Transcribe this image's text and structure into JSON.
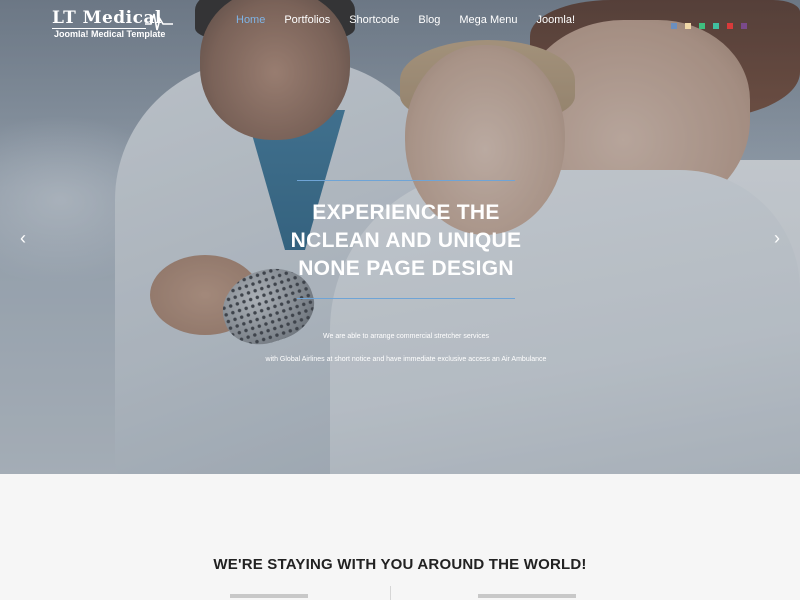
{
  "logo": {
    "title": "LT Medical",
    "subtitle": "Joomla! Medical Template"
  },
  "nav": {
    "items": [
      {
        "label": "Home",
        "active": true
      },
      {
        "label": "Portfolios",
        "active": false
      },
      {
        "label": "Shortcode",
        "active": false
      },
      {
        "label": "Blog",
        "active": false
      },
      {
        "label": "Mega Menu",
        "active": false
      },
      {
        "label": "Joomla!",
        "active": false
      }
    ]
  },
  "color_swatches": [
    "#6b8fbf",
    "#f0d8a8",
    "#3fbf7f",
    "#40c0a0",
    "#d83a3a",
    "#7a4a8a"
  ],
  "hero": {
    "title_lines": [
      "EXPERIENCE THE",
      "NCLEAN AND UNIQUE",
      "NONE PAGE DESIGN"
    ],
    "text_line1": "We are able to arrange commercial stretcher services",
    "text_line2": "with Global Airlines at short notice and have immediate exclusive access an Air Ambulance",
    "prev_arrow": "‹",
    "next_arrow": "›",
    "accent_color": "#6fa4d6"
  },
  "section": {
    "title": "WE'RE STAYING WITH YOU AROUND THE WORLD!"
  }
}
